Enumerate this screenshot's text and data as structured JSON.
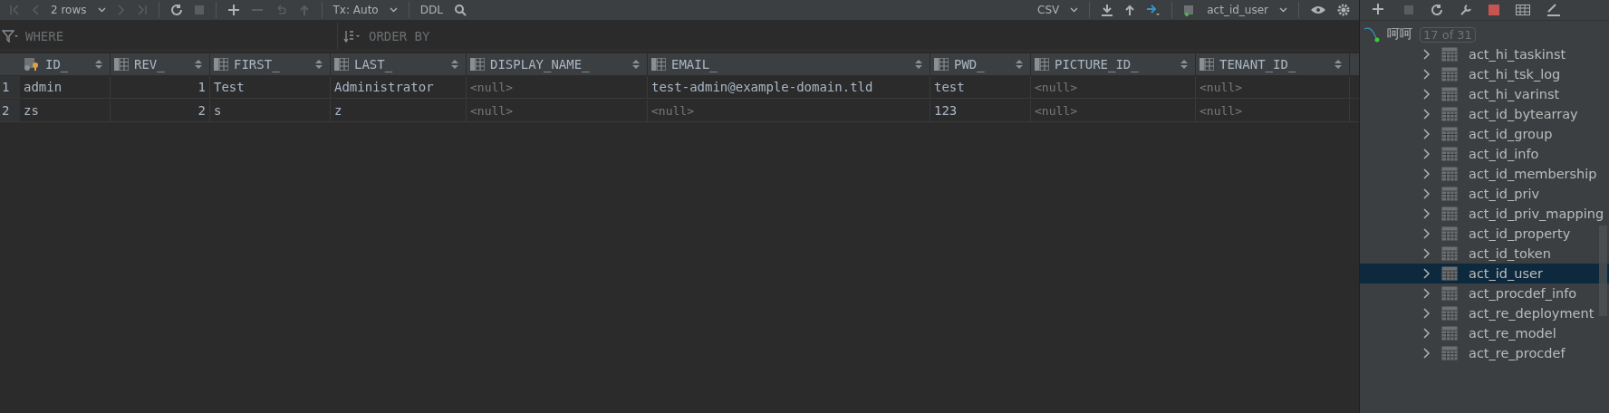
{
  "toolbar": {
    "rows_label": "2 rows",
    "tx_mode": "Tx: Auto",
    "ddl": "DDL",
    "export_format": "CSV",
    "table_name": "act_id_user"
  },
  "filters": {
    "where_placeholder": "WHERE",
    "order_by_placeholder": "ORDER BY"
  },
  "table": {
    "columns": [
      {
        "label": "ID_",
        "kind": "key"
      },
      {
        "label": "REV_",
        "kind": "numeric"
      },
      {
        "label": "FIRST_",
        "kind": "text"
      },
      {
        "label": "LAST_",
        "kind": "text"
      },
      {
        "label": "DISPLAY_NAME_",
        "kind": "text"
      },
      {
        "label": "EMAIL_",
        "kind": "text"
      },
      {
        "label": "PWD_",
        "kind": "text"
      },
      {
        "label": "PICTURE_ID_",
        "kind": "text"
      },
      {
        "label": "TENANT_ID_",
        "kind": "text"
      }
    ],
    "rows": [
      {
        "number": "1",
        "cells": [
          {
            "text": "admin",
            "null": false
          },
          {
            "text": "1",
            "null": false
          },
          {
            "text": "Test",
            "null": false
          },
          {
            "text": "Administrator",
            "null": false
          },
          {
            "text": "<null>",
            "null": true
          },
          {
            "text": "test-admin@example-domain.tld",
            "null": false
          },
          {
            "text": "test",
            "null": false
          },
          {
            "text": "<null>",
            "null": true
          },
          {
            "text": "<null>",
            "null": true
          }
        ]
      },
      {
        "number": "2",
        "cells": [
          {
            "text": "zs",
            "null": false
          },
          {
            "text": "2",
            "null": false
          },
          {
            "text": "s",
            "null": false
          },
          {
            "text": "z",
            "null": false
          },
          {
            "text": "<null>",
            "null": true
          },
          {
            "text": "<null>",
            "null": true
          },
          {
            "text": "123",
            "null": false
          },
          {
            "text": "<null>",
            "null": true
          },
          {
            "text": "<null>",
            "null": true
          }
        ]
      }
    ]
  },
  "database_panel": {
    "source_name": "呵呵",
    "match_count": "17 of 31",
    "items": [
      {
        "label": "act_hi_taskinst",
        "selected": false
      },
      {
        "label": "act_hi_tsk_log",
        "selected": false
      },
      {
        "label": "act_hi_varinst",
        "selected": false
      },
      {
        "label": "act_id_bytearray",
        "selected": false
      },
      {
        "label": "act_id_group",
        "selected": false
      },
      {
        "label": "act_id_info",
        "selected": false
      },
      {
        "label": "act_id_membership",
        "selected": false
      },
      {
        "label": "act_id_priv",
        "selected": false
      },
      {
        "label": "act_id_priv_mapping",
        "selected": false
      },
      {
        "label": "act_id_property",
        "selected": false
      },
      {
        "label": "act_id_token",
        "selected": false
      },
      {
        "label": "act_id_user",
        "selected": true
      },
      {
        "label": "act_procdef_info",
        "selected": false
      },
      {
        "label": "act_re_deployment",
        "selected": false
      },
      {
        "label": "act_re_model",
        "selected": false
      },
      {
        "label": "act_re_procdef",
        "selected": false
      }
    ]
  }
}
